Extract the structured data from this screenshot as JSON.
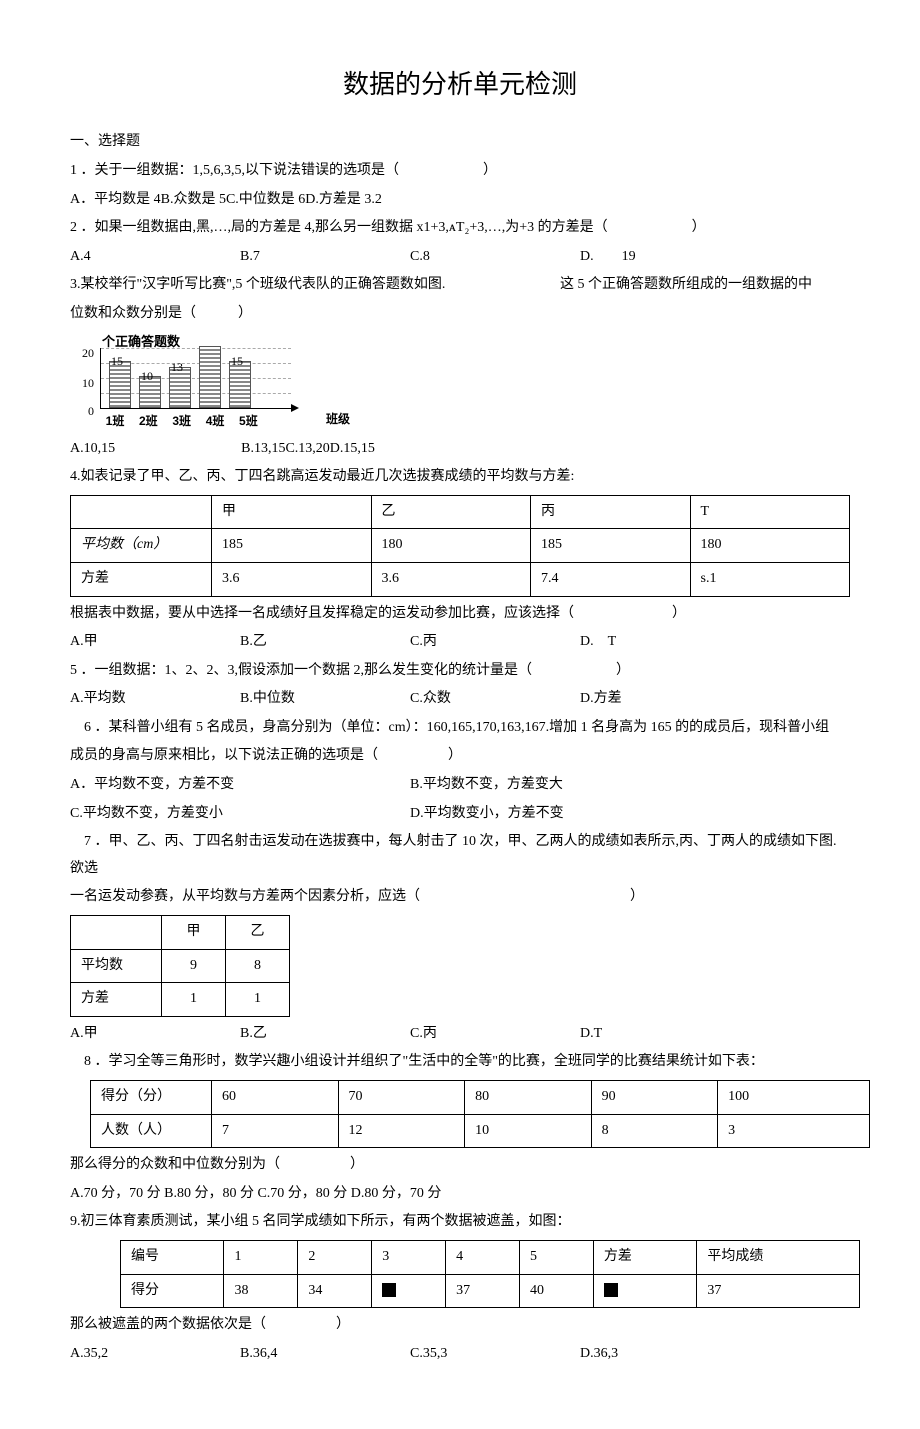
{
  "title": "数据的分析单元检测",
  "section1": "一、选择题",
  "q1": {
    "stem": "1 ．关于一组数据：1,5,6,3,5,以下说法错误的选项是（　　　　　　）",
    "opts": "A．平均数是 4B.众数是 5C.中位数是 6D.方差是 3.2"
  },
  "q2": {
    "stem": "2 ．如果一组数据由,黑,…,局的方差是 4,那么另一组数据 x1+3,ᴀT₂+3,…,为+3 的方差是（　　　　　　）",
    "a": "A.4",
    "b": "B.7",
    "c": "C.8",
    "d": "D.　　19"
  },
  "q3": {
    "stem_l": "3.某校举行\"汉字听写比赛\",5 个班级代表队的正确答题数如图.",
    "stem_r": "这 5 个正确答题数所组成的一组数据的中",
    "stem2": "位数和众数分别是（　　　）",
    "chart_title": "个正确答题数",
    "opts": "A.10,15　　　　　　　　　B.13,15C.13,20D.15,15",
    "xaxis": "班级"
  },
  "chart_data": {
    "type": "bar",
    "categories": [
      "1班",
      "2班",
      "3班",
      "4班",
      "5班"
    ],
    "values": [
      15,
      10,
      13,
      20,
      15
    ],
    "title": "个正确答题数",
    "xlabel": "班级",
    "ylabel": "",
    "ylim": [
      0,
      20
    ],
    "yticks": [
      0,
      10,
      20
    ]
  },
  "q4": {
    "stem": "4.如表记录了甲、乙、丙、丁四名跳高运发动最近几次选拔赛成绩的平均数与方差:",
    "head": [
      "",
      "甲",
      "乙",
      "丙",
      "T"
    ],
    "r1": [
      "平均数（cm）",
      "185",
      "180",
      "185",
      "180"
    ],
    "r2": [
      "方差",
      "3.6",
      "3.6",
      "7.4",
      "s.1"
    ],
    "post": "根据表中数据，要从中选择一名成绩好且发挥稳定的运发动参加比赛，应该选择（　　　　　　　）",
    "a": "A.甲",
    "b": "B.乙",
    "c": "C.丙",
    "d": "D.　T"
  },
  "q5": {
    "stem": "5 ．一组数据：1、2、2、3,假设添加一个数据 2,那么发生变化的统计量是（　　　　　　）",
    "a": "A.平均数",
    "b": "B.中位数",
    "c": "C.众数",
    "d": "D.方差"
  },
  "q6": {
    "stem1": "　6 ．某科普小组有 5 名成员，身高分别为（单位：cm）：160,165,170,163,167.增加 1 名身高为 165 的的成员后，现科普小组",
    "stem2": "成员的身高与原来相比，以下说法正确的选项是（　　　　　）",
    "a": "A．平均数不变，方差不变",
    "b": "B.平均数不变，方差变大",
    "c": "C.平均数不变，方差变小",
    "d": "D.平均数变小，方差不变"
  },
  "q7": {
    "stem1": "　7 ．甲、乙、丙、丁四名射击运发动在选拔赛中，每人射击了 10 次，甲、乙两人的成绩如表所示,丙、丁两人的成绩如下图.欲选",
    "stem2": "一名运发动参赛，从平均数与方差两个因素分析，应选（　　　　　　　　　　　　　　　）",
    "head": [
      "",
      "甲",
      "乙"
    ],
    "r1": [
      "平均数",
      "9",
      "8"
    ],
    "r2": [
      "方差",
      "1",
      "1"
    ],
    "a": "A.甲",
    "b": "B.乙",
    "c": "C.丙",
    "d": "D.T"
  },
  "q8": {
    "stem": "　8 ．学习全等三角形时，数学兴趣小组设计并组织了\"生活中的全等\"的比赛，全班同学的比赛结果统计如下表：",
    "head": [
      "得分（分）",
      "60",
      "70",
      "80",
      "90",
      "100"
    ],
    "r1": [
      "人数（人）",
      "7",
      "12",
      "10",
      "8",
      "3"
    ],
    "post": "那么得分的众数和中位数分别为（　　　　　）",
    "opts": "A.70 分，70 分 B.80 分，80 分 C.70 分，80 分 D.80 分，70 分"
  },
  "q9": {
    "stem": "9.初三体育素质测试，某小组 5 名同学成绩如下所示，有两个数据被遮盖，如图：",
    "head": [
      "编号",
      "1",
      "2",
      "3",
      "4",
      "5",
      "方差",
      "平均成绩"
    ],
    "r1": [
      "得分",
      "38",
      "34",
      "■",
      "37",
      "40",
      "■",
      "37"
    ],
    "post": "那么被遮盖的两个数据依次是（　　　　　）",
    "a": "A.35,2",
    "b": "B.36,4",
    "c": "C.35,3",
    "d": "D.36,3"
  }
}
